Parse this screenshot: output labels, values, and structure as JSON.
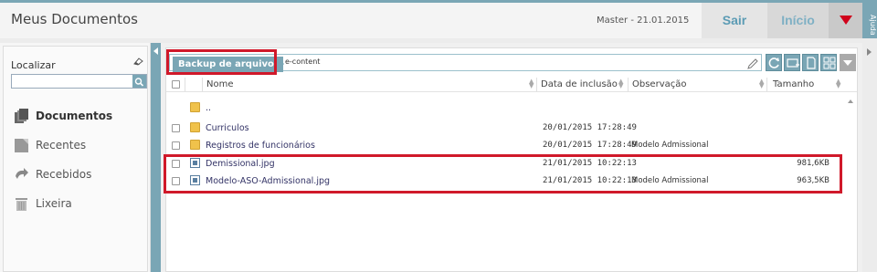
{
  "header": {
    "title": "Meus Documentos",
    "session": "Master  -  21.01.2015",
    "sair_label": "Sair",
    "inicio_label": "Início",
    "ajuda_label": "Ajuda"
  },
  "sidebar": {
    "search_label": "Localizar",
    "search_value": "",
    "items": [
      {
        "label": "Documentos",
        "icon": "documents-icon",
        "active": true
      },
      {
        "label": "Recentes",
        "icon": "recent-icon",
        "active": false
      },
      {
        "label": "Recebidos",
        "icon": "received-icon",
        "active": false
      },
      {
        "label": "Lixeira",
        "icon": "trash-icon",
        "active": false
      }
    ]
  },
  "path": {
    "crumb": "Backup de arquivos",
    "rest": "e-content"
  },
  "table": {
    "columns": [
      "Nome",
      "Data de inclusão",
      "Observação",
      "Tamanho"
    ],
    "rows": [
      {
        "type": "folder",
        "name": "..",
        "date": "",
        "obs": "",
        "size": ""
      },
      {
        "type": "folder",
        "name": "Curriculos",
        "date": "20/01/2015 17:28:49",
        "obs": "",
        "size": ""
      },
      {
        "type": "folder",
        "name": "Registros de funcionários",
        "date": "20/01/2015 17:28:49",
        "obs": "Modelo Admissional",
        "size": ""
      },
      {
        "type": "image",
        "name": "Demissional.jpg",
        "date": "21/01/2015 10:22:13",
        "obs": "",
        "size": "981,6KB"
      },
      {
        "type": "image",
        "name": "Modelo-ASO-Admissional.jpg",
        "date": "21/01/2015 10:22:13",
        "obs": "Modelo Admissional",
        "size": "963,5KB"
      }
    ]
  },
  "colors": {
    "accent": "#7aa6b5",
    "highlight": "#d0192a",
    "menu_arrow": "#d0021b"
  }
}
